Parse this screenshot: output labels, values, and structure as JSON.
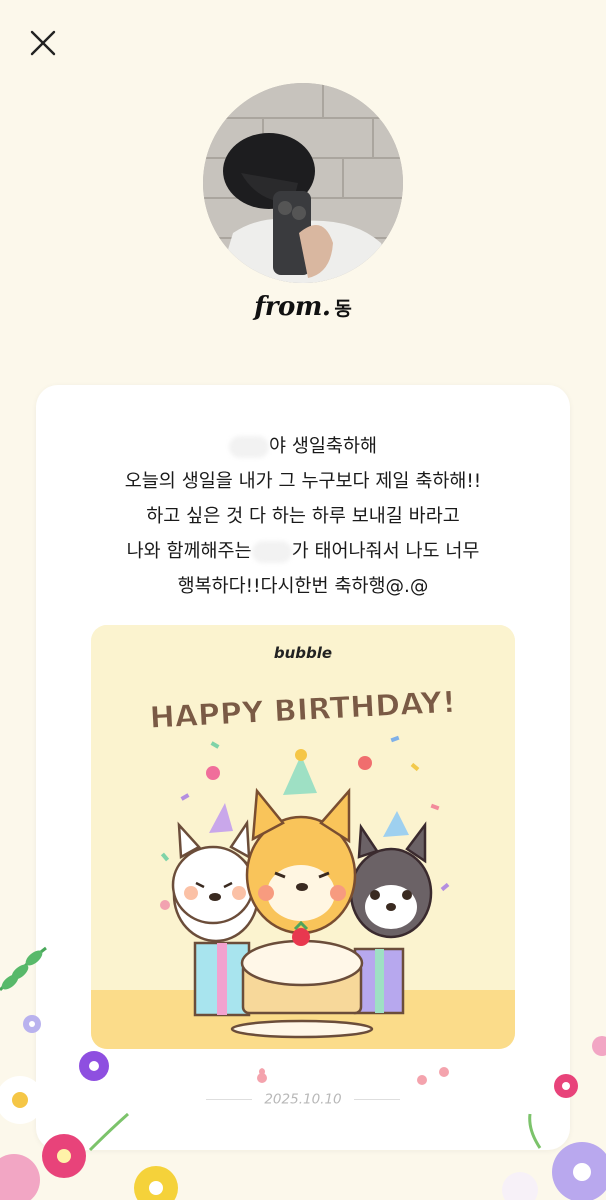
{
  "sender": {
    "prefix": "from.",
    "name": "동"
  },
  "message": {
    "line1_suffix": "야 생일축하해",
    "line2": "오늘의 생일을 내가 그 누구보다 제일 축하해!!",
    "line3": "하고 싶은 것 다 하는 하루 보내길 바라고",
    "line4_before": "나와 함께해주는",
    "line4_after": "가 태어나줘서 나도 너무",
    "line5": "행복하다!!다시한번 축하행@.@"
  },
  "gift_card": {
    "brand": "bubble",
    "title": "HAPPY BIRTHDAY!",
    "background_color": "#fbf3cf",
    "title_color": "#7a5a45"
  },
  "date": "2025.10.10",
  "icons": {
    "close": "close-icon"
  }
}
